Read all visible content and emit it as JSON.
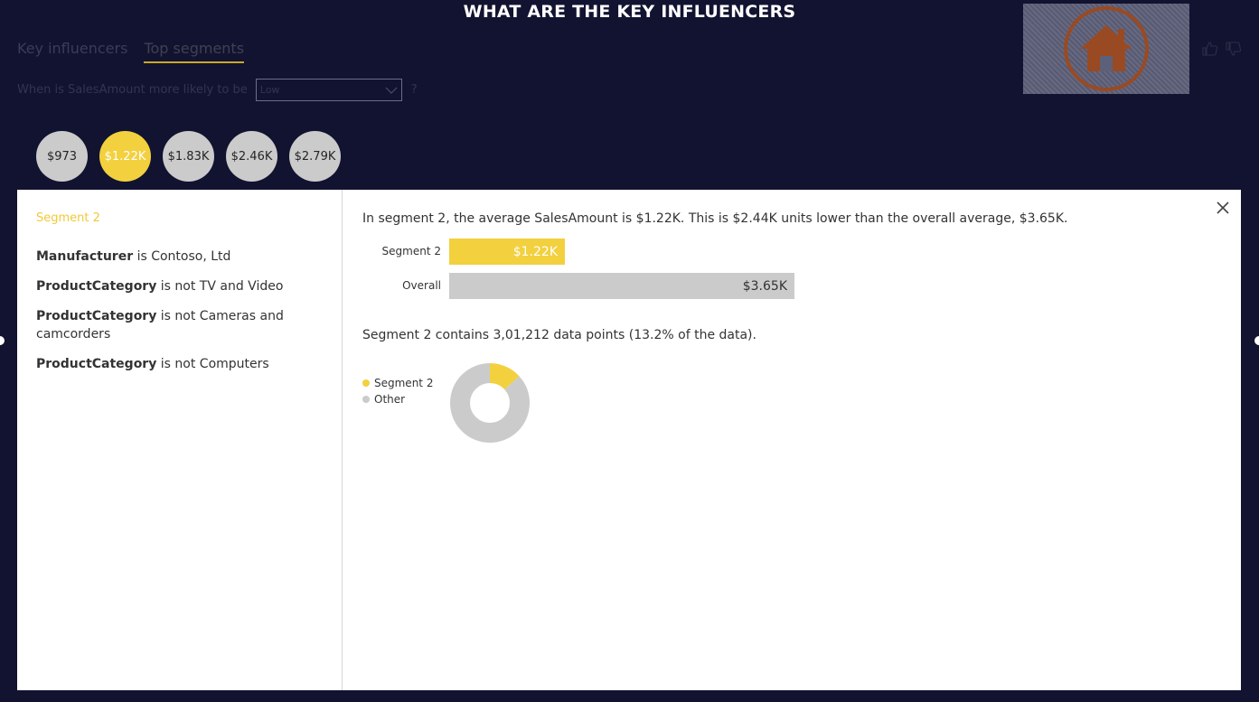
{
  "report": {
    "title": "WHAT ARE THE KEY INFLUENCERS"
  },
  "tabs": [
    {
      "label": "Key influencers",
      "active": false
    },
    {
      "label": "Top segments",
      "active": true
    }
  ],
  "question": {
    "label": "When is SalesAmount more likely to be",
    "selected_value": "Low",
    "help": "?"
  },
  "icons": {
    "home": "home-icon",
    "thumbs_up": "thumbs-up-icon",
    "thumbs_down": "thumbs-down-icon",
    "close": "close-icon",
    "dropdown": "chevron-down-icon"
  },
  "colors": {
    "background": "#121330",
    "accent": "#f3d03e",
    "neutral": "#cbcbcb",
    "home_icon": "#9a4a22"
  },
  "segments": [
    {
      "label": "$973",
      "active": false
    },
    {
      "label": "$1.22K",
      "active": true
    },
    {
      "label": "$1.83K",
      "active": false
    },
    {
      "label": "$2.46K",
      "active": false
    },
    {
      "label": "$2.79K",
      "active": false
    }
  ],
  "panel": {
    "heading": "Segment 2",
    "conditions": [
      {
        "field": "ProductCategory",
        "text": " is not Computers"
      }
    ],
    "condition_1": {
      "field": "Manufacturer",
      "text": " is Contoso, Ltd"
    },
    "condition_2": {
      "field": "ProductCategory",
      "text": " is not TV and Video"
    },
    "condition_3": {
      "field": "ProductCategory",
      "text": " is not Cameras and camcorders"
    },
    "condition_4": {
      "field": "ProductCategory",
      "text": " is not Computers"
    },
    "summary": "In segment 2, the average SalesAmount is $1.22K. This is $2.44K units lower than the overall average, $3.65K.",
    "contains": "Segment 2 contains 3,01,212 data points (13.2% of the data)."
  },
  "chart_data": [
    {
      "type": "bar",
      "orientation": "horizontal",
      "categories": [
        "Segment 2",
        "Overall"
      ],
      "values": [
        1220,
        3650
      ],
      "value_labels": [
        "$1.22K",
        "$3.65K"
      ],
      "xlim": [
        0,
        3650
      ]
    },
    {
      "type": "pie",
      "donut": true,
      "labels": [
        "Segment 2",
        "Other"
      ],
      "values": [
        13.2,
        86.8
      ],
      "colors": [
        "#f3d03e",
        "#cbcbcb"
      ],
      "legend": "left"
    }
  ]
}
